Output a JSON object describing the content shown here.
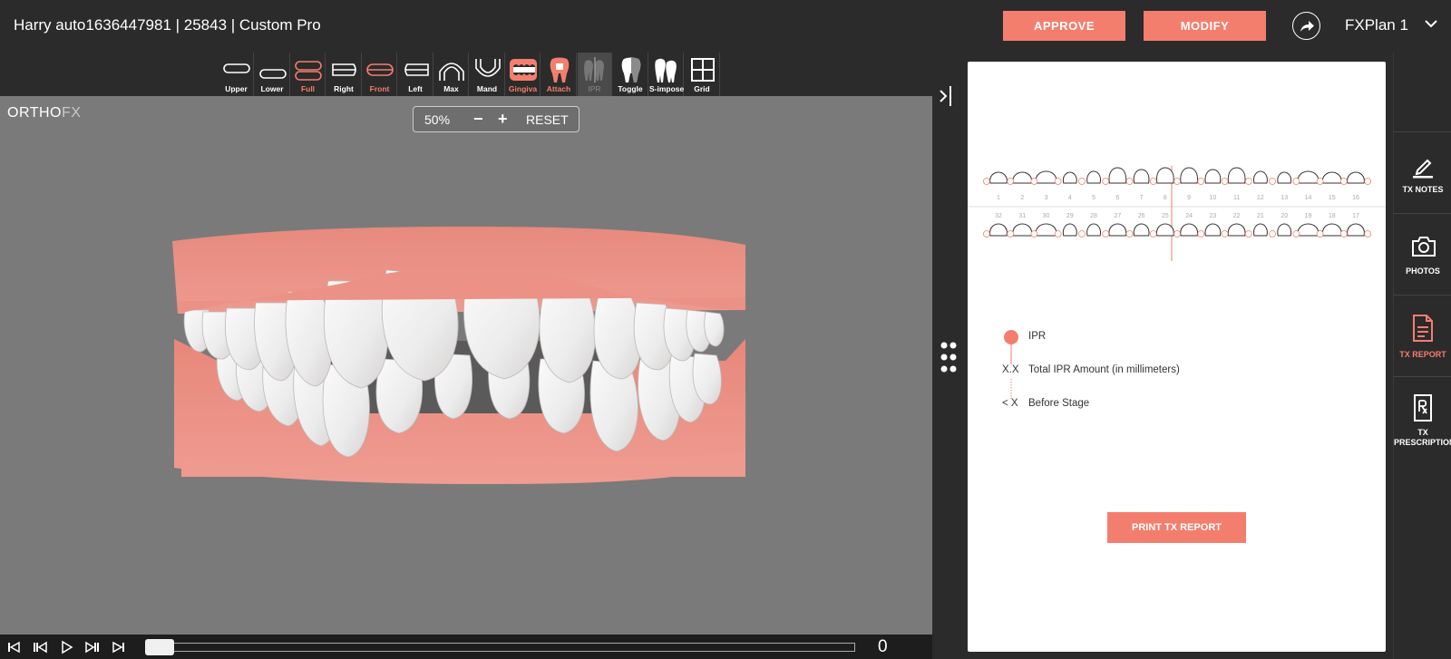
{
  "header": {
    "patient_title": "Harry auto1636447981 | 25843 | Custom Pro",
    "approve_label": "APPROVE",
    "modify_label": "MODIFY",
    "plan_name": "FXPlan 1"
  },
  "toolbar": {
    "tools": [
      {
        "label": "Upper",
        "icon": "upper-arch-icon",
        "active": false
      },
      {
        "label": "Lower",
        "icon": "lower-arch-icon",
        "active": false
      },
      {
        "label": "Full",
        "icon": "full-arch-icon",
        "active": true
      },
      {
        "label": "Right",
        "icon": "right-view-icon",
        "active": false
      },
      {
        "label": "Front",
        "icon": "front-view-icon",
        "active": true
      },
      {
        "label": "Left",
        "icon": "left-view-icon",
        "active": false
      },
      {
        "label": "Max",
        "icon": "maxillary-icon",
        "active": false
      },
      {
        "label": "Mand",
        "icon": "mandibular-icon",
        "active": false
      },
      {
        "label": "Gingiva",
        "icon": "gingiva-icon",
        "active": true
      },
      {
        "label": "Attach",
        "icon": "attachment-icon",
        "active": true
      },
      {
        "label": "IPR",
        "icon": "ipr-icon",
        "active": false
      },
      {
        "label": "Toggle",
        "icon": "tooth-toggle-icon",
        "active": false
      },
      {
        "label": "S-impose",
        "icon": "superimpose-icon",
        "active": false
      },
      {
        "label": "Grid",
        "icon": "grid-icon",
        "active": false
      }
    ]
  },
  "viewport": {
    "logo_main": "ORTHO",
    "logo_accent": "FX",
    "zoom_level": "50%",
    "zoom_minus": "−",
    "zoom_plus": "+",
    "zoom_reset": "RESET"
  },
  "playback": {
    "current_stage": "0",
    "progress": 0.0
  },
  "report": {
    "upper_teeth": [
      "1",
      "2",
      "3",
      "4",
      "5",
      "6",
      "7",
      "8",
      "9",
      "10",
      "11",
      "12",
      "13",
      "14",
      "15",
      "16"
    ],
    "lower_teeth": [
      "32",
      "31",
      "30",
      "29",
      "28",
      "27",
      "26",
      "25",
      "24",
      "23",
      "22",
      "21",
      "20",
      "19",
      "18",
      "17"
    ],
    "legend": {
      "ipr_label": "IPR",
      "amount_symbol": "X.X",
      "amount_label": "Total IPR Amount (in millimeters)",
      "stage_symbol": "< X",
      "stage_label": "Before Stage"
    },
    "print_label": "PRINT TX REPORT"
  },
  "nav": {
    "tx_notes": "TX NOTES",
    "photos": "PHOTOS",
    "tx_report": "TX REPORT",
    "tx_prescription_1": "TX",
    "tx_prescription_2": "PRESCRIPTION"
  },
  "colors": {
    "accent": "#f47e6e",
    "gingiva": "#ec9185",
    "background": "#2b2b2b",
    "viewport": "#7a7a7a"
  }
}
